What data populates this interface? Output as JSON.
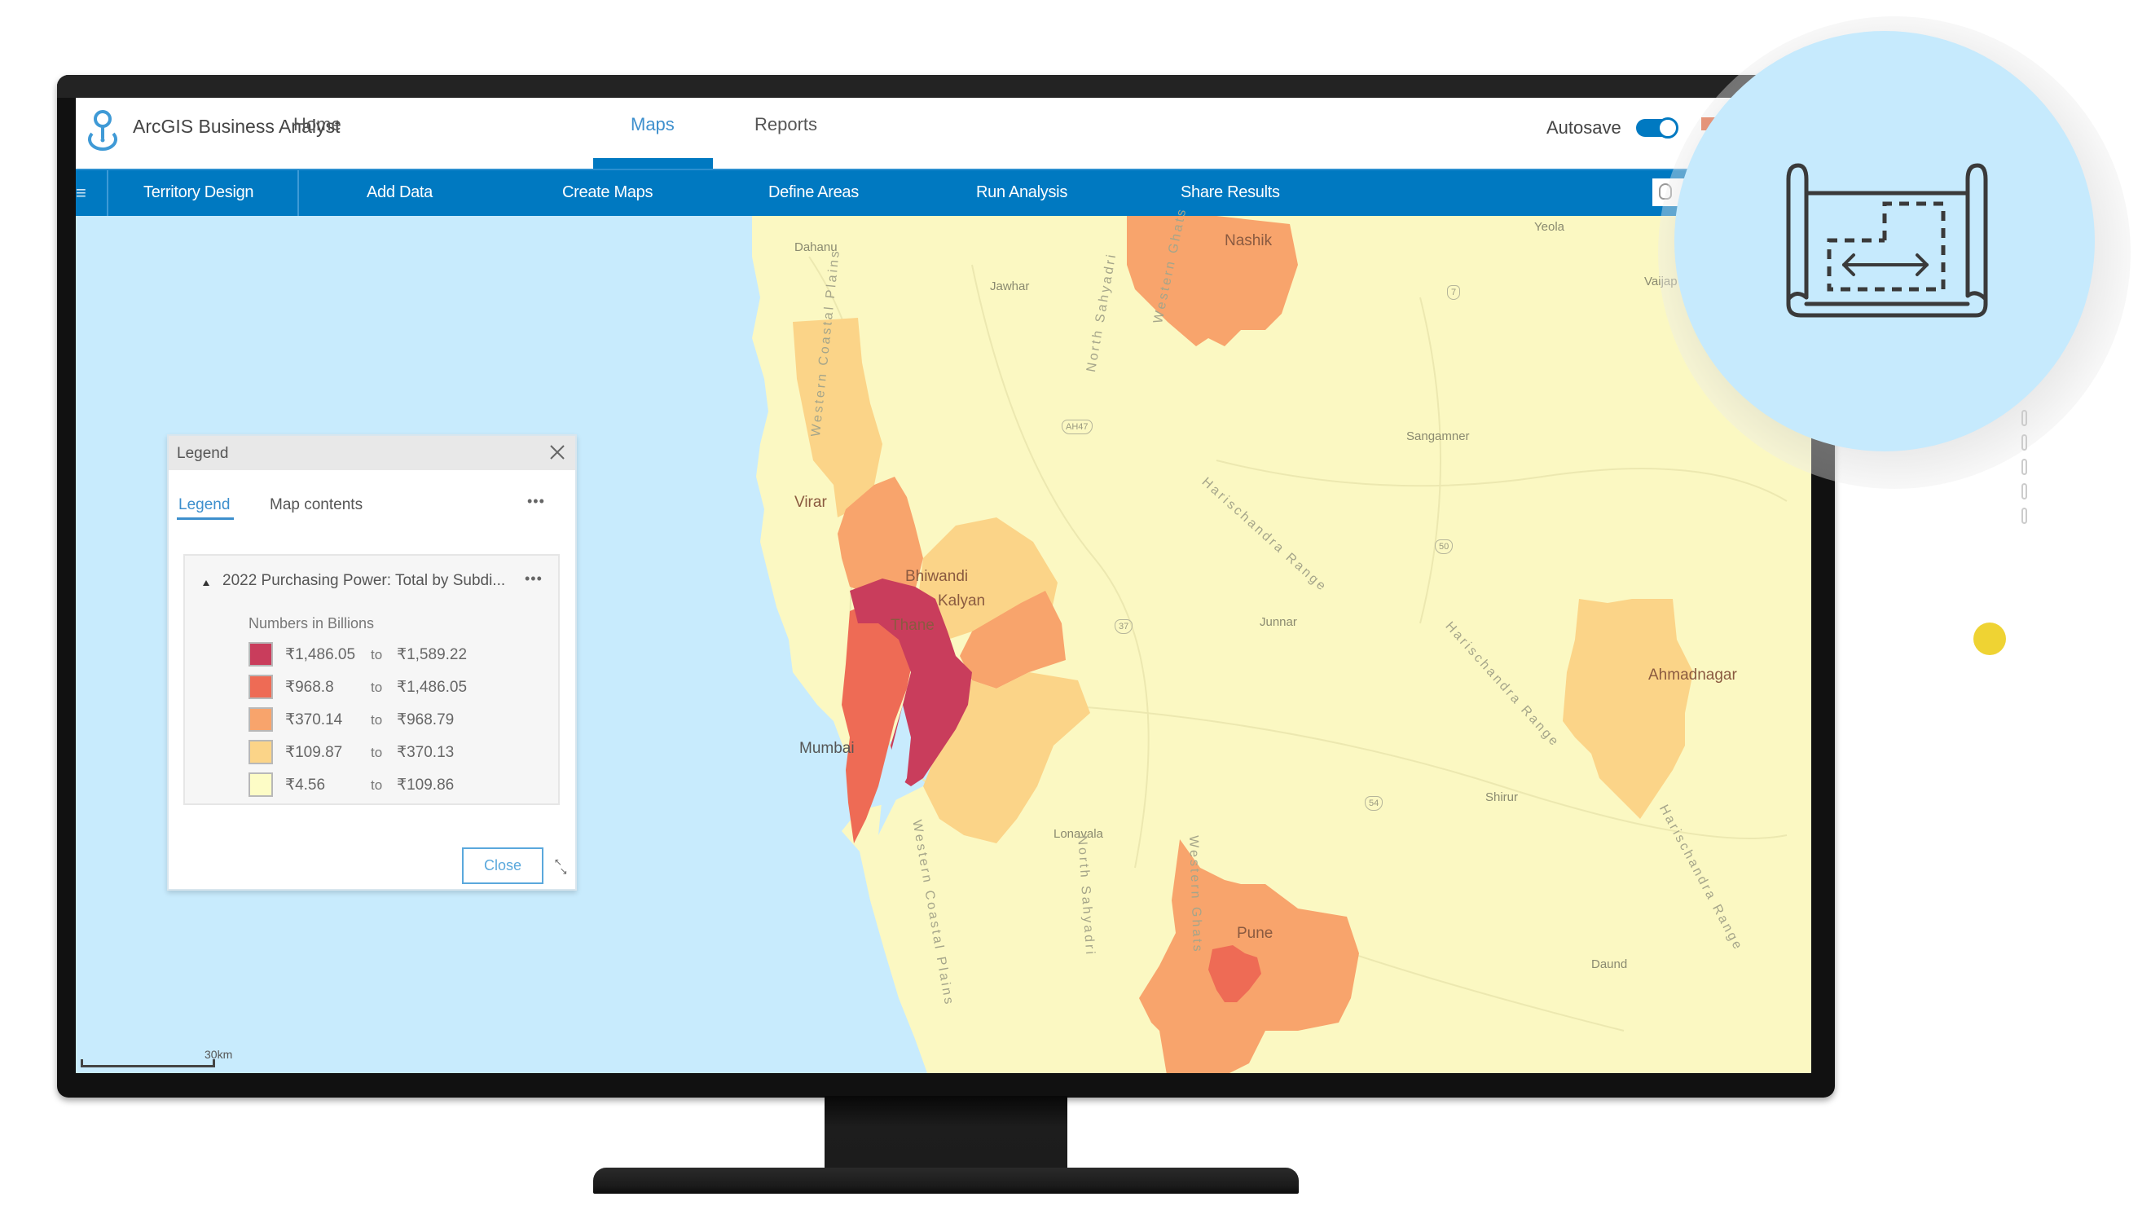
{
  "app": {
    "title": "ArcGIS Business Analyst",
    "logo_icon": "location-pin-icon"
  },
  "top_tabs": [
    {
      "label": "Home",
      "active": false
    },
    {
      "label": "Maps",
      "active": true
    },
    {
      "label": "Reports",
      "active": false
    }
  ],
  "autosave": {
    "label": "Autosave",
    "enabled": true
  },
  "nav_bar": {
    "menu_icon": "hamburger-menu-icon",
    "items": [
      {
        "label": "Territory Design"
      },
      {
        "label": "Add Data"
      },
      {
        "label": "Create Maps"
      },
      {
        "label": "Define Areas"
      },
      {
        "label": "Run Analysis"
      },
      {
        "label": "Share Results"
      }
    ],
    "search_icon": "search-icon"
  },
  "map": {
    "places": [
      {
        "name": "Dahanu"
      },
      {
        "name": "Jawhar"
      },
      {
        "name": "Nashik"
      },
      {
        "name": "Yeola"
      },
      {
        "name": "Vaijap"
      },
      {
        "name": "Sangamner"
      },
      {
        "name": "Virar"
      },
      {
        "name": "Bhiwandi"
      },
      {
        "name": "Kalyan"
      },
      {
        "name": "Thane"
      },
      {
        "name": "Mumbai"
      },
      {
        "name": "Junnar"
      },
      {
        "name": "Ahmadnagar"
      },
      {
        "name": "Shirur"
      },
      {
        "name": "Lonavala"
      },
      {
        "name": "Pune"
      },
      {
        "name": "Daund"
      }
    ],
    "ranges": [
      {
        "name": "Western Coastal Plains"
      },
      {
        "name": "North Sahyadri"
      },
      {
        "name": "Western Ghats"
      },
      {
        "name": "Harischandra Range"
      }
    ],
    "road_shields": [
      "AH47",
      "7",
      "50",
      "37",
      "54"
    ],
    "scale_bar_label": "30km"
  },
  "legend": {
    "panel_title": "Legend",
    "tabs": [
      {
        "label": "Legend",
        "active": true
      },
      {
        "label": "Map contents",
        "active": false
      }
    ],
    "more_label": "•••",
    "layer_title": "2022 Purchasing Power: Total by Subdi...",
    "units_label": "Numbers in Billions",
    "connector": "to",
    "classes": [
      {
        "from": "₹1,486.05",
        "to": "₹1,589.22",
        "color": "#c93d5c"
      },
      {
        "from": "₹968.8",
        "to": "₹1,486.05",
        "color": "#ee6b55"
      },
      {
        "from": "₹370.14",
        "to": "₹968.79",
        "color": "#f8a46c"
      },
      {
        "from": "₹109.87",
        "to": "₹370.13",
        "color": "#fbd488"
      },
      {
        "from": "₹4.56",
        "to": "₹109.86",
        "color": "#fdfcc6"
      }
    ],
    "close_button": "Close"
  },
  "colors": {
    "brand_blue": "#0079c1",
    "water": "#c8ebfd",
    "land": "#fbf8c2",
    "highlight_circle": "#c6eafd",
    "accent_dot": "#efd333"
  },
  "overlay": {
    "feature_icon": "territory-design-map-icon"
  }
}
